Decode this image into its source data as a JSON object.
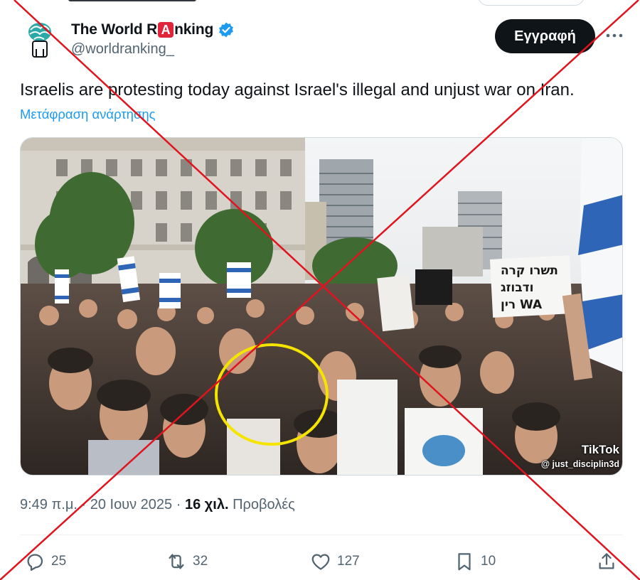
{
  "author": {
    "name_before": "The World R",
    "name_highlight": "A",
    "name_after": "nking",
    "handle": "@worldranking_",
    "verified_icon": "verified-badge-icon"
  },
  "follow_label": "Εγγραφή",
  "more_icon": "more-dots-icon",
  "tweet": {
    "text": "Israelis are protesting today against Israel's illegal and unjust war on Iran.",
    "translate": "Μετάφραση ανάρτησης"
  },
  "media": {
    "sign_line1": "תשרו קרה",
    "sign_line2": "ודבוזג",
    "sign_line3": "רין WA",
    "watermark_brand": "TikTok",
    "watermark_user": "@ just_disciplin3d"
  },
  "meta": {
    "time": "9:49 π.μ.",
    "sep1": " · ",
    "date": "20 Ιουν 2025",
    "sep2": " · ",
    "views_count": "16 χιλ.",
    "views_label": " Προβολές"
  },
  "actions": {
    "replies": "25",
    "reposts": "32",
    "likes": "127",
    "bookmarks": "10"
  },
  "colors": {
    "accent_link": "#1d9bf0",
    "verified": "#1d9bf0",
    "cross_overlay": "#e0141e",
    "highlight_circle": "#f5e400",
    "name_badge": "#e0243a"
  }
}
